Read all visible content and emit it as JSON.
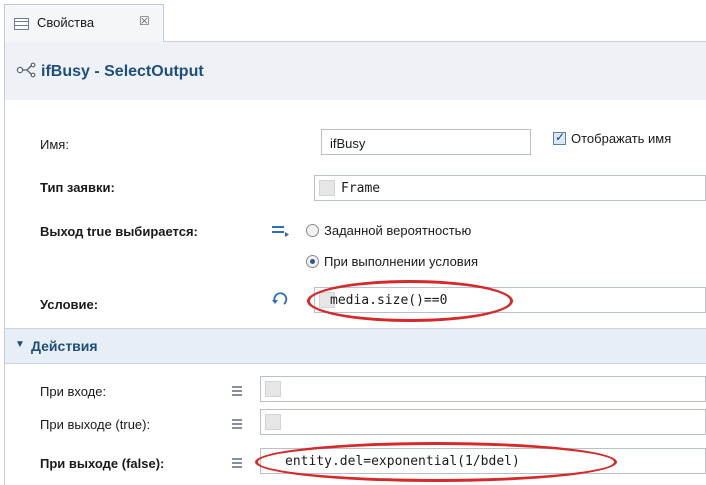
{
  "tab": {
    "label": "Свойства",
    "close_glyph": "☒"
  },
  "header": {
    "title": "ifBusy - SelectOutput",
    "icon": "select-output-icon"
  },
  "form": {
    "name": {
      "label": "Имя:",
      "value": "ifBusy"
    },
    "show_name": {
      "label": "Отображать имя",
      "checked": true
    },
    "request_type": {
      "label": "Тип заявки:",
      "value": "Frame"
    },
    "true_output": {
      "label": "Выход true выбирается:",
      "options": [
        "Заданной вероятностью",
        "При выполнении условия"
      ],
      "selected_index": 1
    },
    "condition": {
      "label": "Условие:",
      "value": "media.size()==0"
    }
  },
  "actions": {
    "title": "Действия",
    "on_enter": {
      "label": "При входе:",
      "value": ""
    },
    "on_exit_true": {
      "label": "При выходе (true):",
      "value": ""
    },
    "on_exit_false": {
      "label": "При выходе (false):",
      "value": "entity.del=exponential(1/bdel)"
    }
  },
  "annotation_color": "#d42a2a",
  "accent_color": "#1f4e79"
}
